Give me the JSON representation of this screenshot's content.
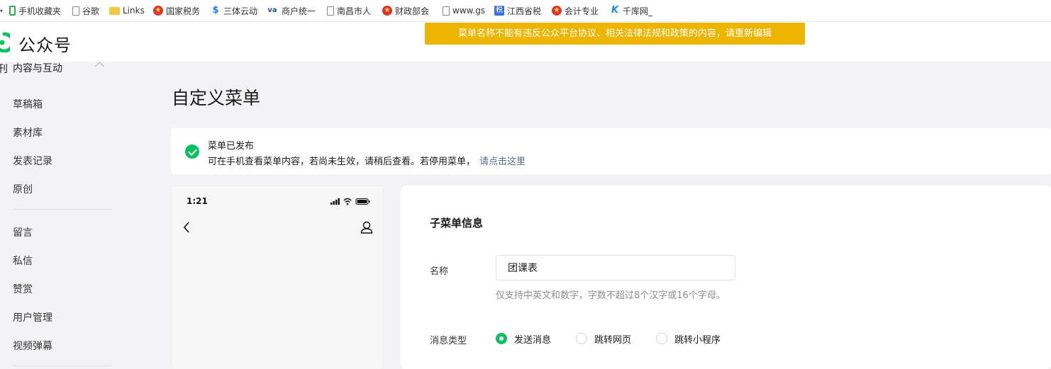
{
  "bookmarks": [
    {
      "icon": "phone-icon",
      "label": "手机收藏夹"
    },
    {
      "icon": "page-icon",
      "label": "谷歌"
    },
    {
      "icon": "folder-icon",
      "label": "Links"
    },
    {
      "icon": "emblem-icon",
      "label": "国家税务"
    },
    {
      "icon": "s-logo-icon",
      "label": "三体云动"
    },
    {
      "icon": "va-logo-icon",
      "label": "商户统一"
    },
    {
      "icon": "page-icon",
      "label": "南昌市人"
    },
    {
      "icon": "emblem-icon",
      "label": "财政部会"
    },
    {
      "icon": "page-icon",
      "label": "www.gs"
    },
    {
      "icon": "jx-logo-icon",
      "label": "江西省税"
    },
    {
      "icon": "emblem-icon",
      "label": "会计专业"
    },
    {
      "icon": "k-logo-icon",
      "label": "千库网_"
    }
  ],
  "header": {
    "title": "公众号",
    "toast": "菜单名称不能有违反公众平台协议、相关法律法规和政策的内容，请重新编辑"
  },
  "sidebar": {
    "group": "内容与互动",
    "group_icon": "刊",
    "items_a": [
      "草稿箱",
      "素材库",
      "发表记录",
      "原创"
    ],
    "items_b": [
      "留言",
      "私信",
      "赞赏",
      "用户管理",
      "视频弹幕"
    ]
  },
  "main": {
    "title": "自定义菜单",
    "notice": {
      "title": "菜单已发布",
      "desc": "可在手机查看菜单内容，若尚未生效，请稍后查看。若停用菜单，",
      "link": "请点击这里"
    },
    "phone": {
      "time": "1:21"
    },
    "editor": {
      "title": "子菜单信息",
      "name_label": "名称",
      "name_value": "团课表",
      "hint": "仅支持中英文和数字，字数不超过8个汉字或16个字母。",
      "type_label": "消息类型",
      "options": [
        "发送消息",
        "跳转网页",
        "跳转小程序"
      ],
      "selected": "发送消息"
    }
  },
  "colors": {
    "accent": "#07c160",
    "toast": "#edb400",
    "link": "#576b95"
  }
}
